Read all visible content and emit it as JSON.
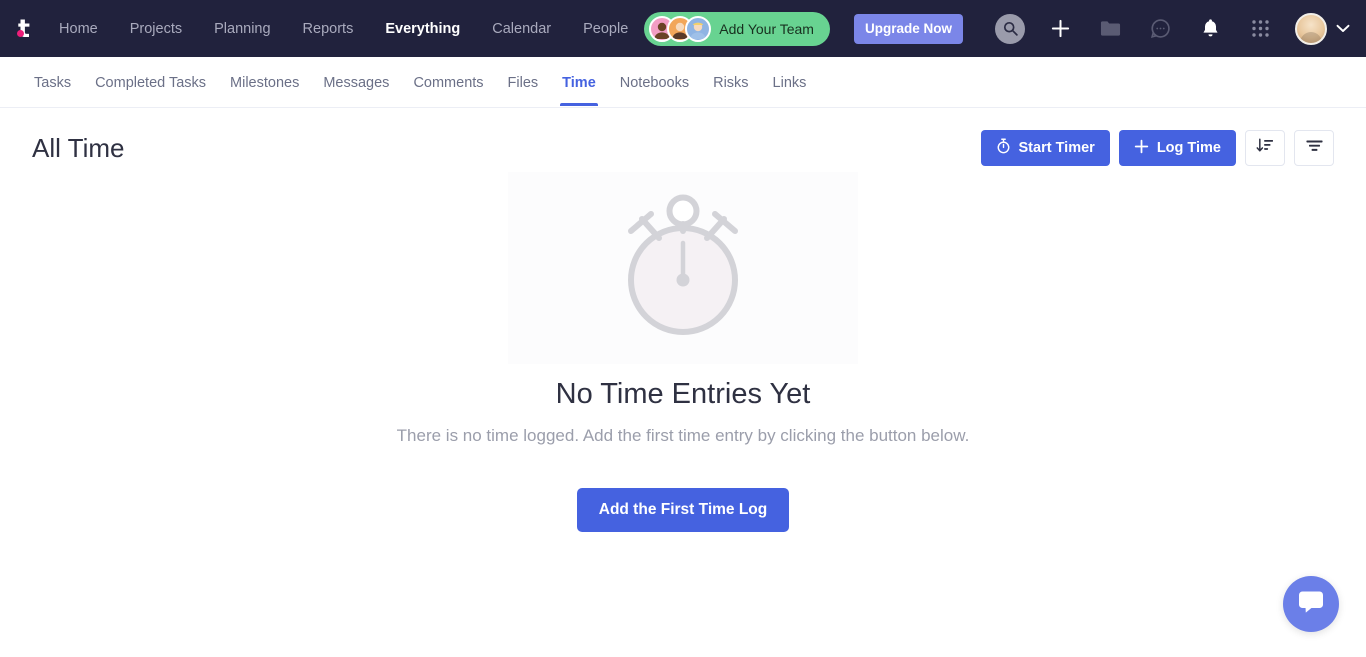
{
  "brand": {
    "logo_letter": "t",
    "accent": "#ed1e79",
    "header_bg": "#21223d",
    "primary": "#4562e0"
  },
  "header": {
    "nav": [
      {
        "label": "Home",
        "active": false
      },
      {
        "label": "Projects",
        "active": false
      },
      {
        "label": "Planning",
        "active": false
      },
      {
        "label": "Reports",
        "active": false
      },
      {
        "label": "Everything",
        "active": true
      },
      {
        "label": "Calendar",
        "active": false
      },
      {
        "label": "People",
        "active": false
      }
    ],
    "team_pill_label": "Add Your Team",
    "team_pill_color": "#68d391",
    "upgrade_label": "Upgrade Now",
    "upgrade_color": "#7b86e8",
    "icons": [
      "search-icon",
      "plus-icon",
      "folder-icon",
      "chat-icon",
      "bell-icon",
      "apps-grid-icon"
    ]
  },
  "subnav": {
    "tabs": [
      {
        "label": "Tasks",
        "active": false
      },
      {
        "label": "Completed Tasks",
        "active": false
      },
      {
        "label": "Milestones",
        "active": false
      },
      {
        "label": "Messages",
        "active": false
      },
      {
        "label": "Comments",
        "active": false
      },
      {
        "label": "Files",
        "active": false
      },
      {
        "label": "Time",
        "active": true
      },
      {
        "label": "Notebooks",
        "active": false
      },
      {
        "label": "Risks",
        "active": false
      },
      {
        "label": "Links",
        "active": false
      }
    ]
  },
  "page": {
    "title": "All Time",
    "start_timer_label": "Start Timer",
    "log_time_label": "Log Time",
    "sort_icon": "sort-descending-icon",
    "filter_icon": "filter-icon"
  },
  "empty_state": {
    "illustration": "stopwatch-icon",
    "title": "No Time Entries Yet",
    "description": "There is no time logged. Add the first time entry by clicking the button below.",
    "cta_label": "Add the First Time Log"
  },
  "chat_widget": {
    "icon": "chat-bubble-icon",
    "color": "#6b7fe8"
  }
}
